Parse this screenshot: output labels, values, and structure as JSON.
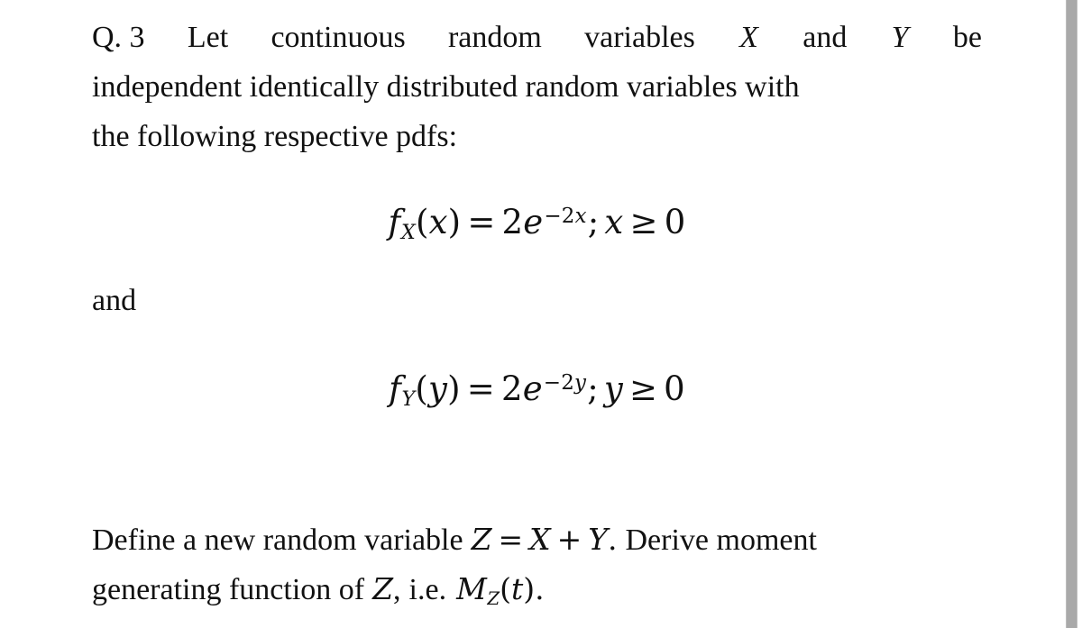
{
  "document": {
    "question_label": "Q. 3",
    "paragraph1": {
      "line1": {
        "words": [
          "Q. 3",
          "Let",
          "continuous",
          "random",
          "variables",
          "X",
          "and",
          "Y",
          "be"
        ],
        "text": "Q. 3 Let continuous random variables X and Y be"
      },
      "line2": {
        "text": "independent identically distributed random variables with"
      },
      "line3": {
        "text": "the following respective pdfs:"
      }
    },
    "connector": "and",
    "equation1": {
      "latex": "f_X(x) = 2e^{-2x}; x \\ge 0",
      "plain": "fX(x) = 2e^-2x; x ≥ 0",
      "function_name": "f",
      "subscript": "X",
      "argument_open": "(",
      "argument": "x",
      "argument_close": ")",
      "equals": "=",
      "coefficient": "2",
      "base": "e",
      "exponent_sign": "−",
      "exponent_coefficient": "2",
      "exponent_variable": "x",
      "separator": ";",
      "domain_variable": "x",
      "domain_relation": "≥",
      "domain_bound": "0"
    },
    "equation2": {
      "latex": "f_Y(y) = 2e^{-2y}; y \\ge 0",
      "plain": "fY(y) = 2e^-2y; y ≥ 0",
      "function_name": "f",
      "subscript": "Y",
      "argument_open": "(",
      "argument": "y",
      "argument_close": ")",
      "equals": "=",
      "coefficient": "2",
      "base": "e",
      "exponent_sign": "−",
      "exponent_coefficient": "2",
      "exponent_variable": "y",
      "separator": ";",
      "domain_variable": "y",
      "domain_relation": "≥",
      "domain_bound": "0"
    },
    "paragraph2": {
      "line1": {
        "lead_text": "Define a new random variable",
        "eq_z": "Z",
        "eq_equals": "=",
        "eq_x": "X",
        "eq_plus": "+",
        "eq_y": "Y",
        "eq_period": ".",
        "trail_text": "Derive moment",
        "text": "Define a new random variable Z = X + Y. Derive moment"
      },
      "line2": {
        "lead_text": "generating function of",
        "var_z": "Z",
        "comma": ",",
        "ie_text": "i.e.",
        "mgf_name": "M",
        "mgf_subscript": "Z",
        "mgf_open": "(",
        "mgf_argument": "t",
        "mgf_close": ")",
        "period": ".",
        "text": "generating function of Z, i.e. MZ(t)."
      }
    }
  },
  "scrollbar": {
    "orientation": "vertical",
    "thumb_color": "#a9a9a9",
    "track_color": "#ffffff"
  },
  "colors": {
    "page_background": "#ffffff",
    "text": "#111111"
  }
}
